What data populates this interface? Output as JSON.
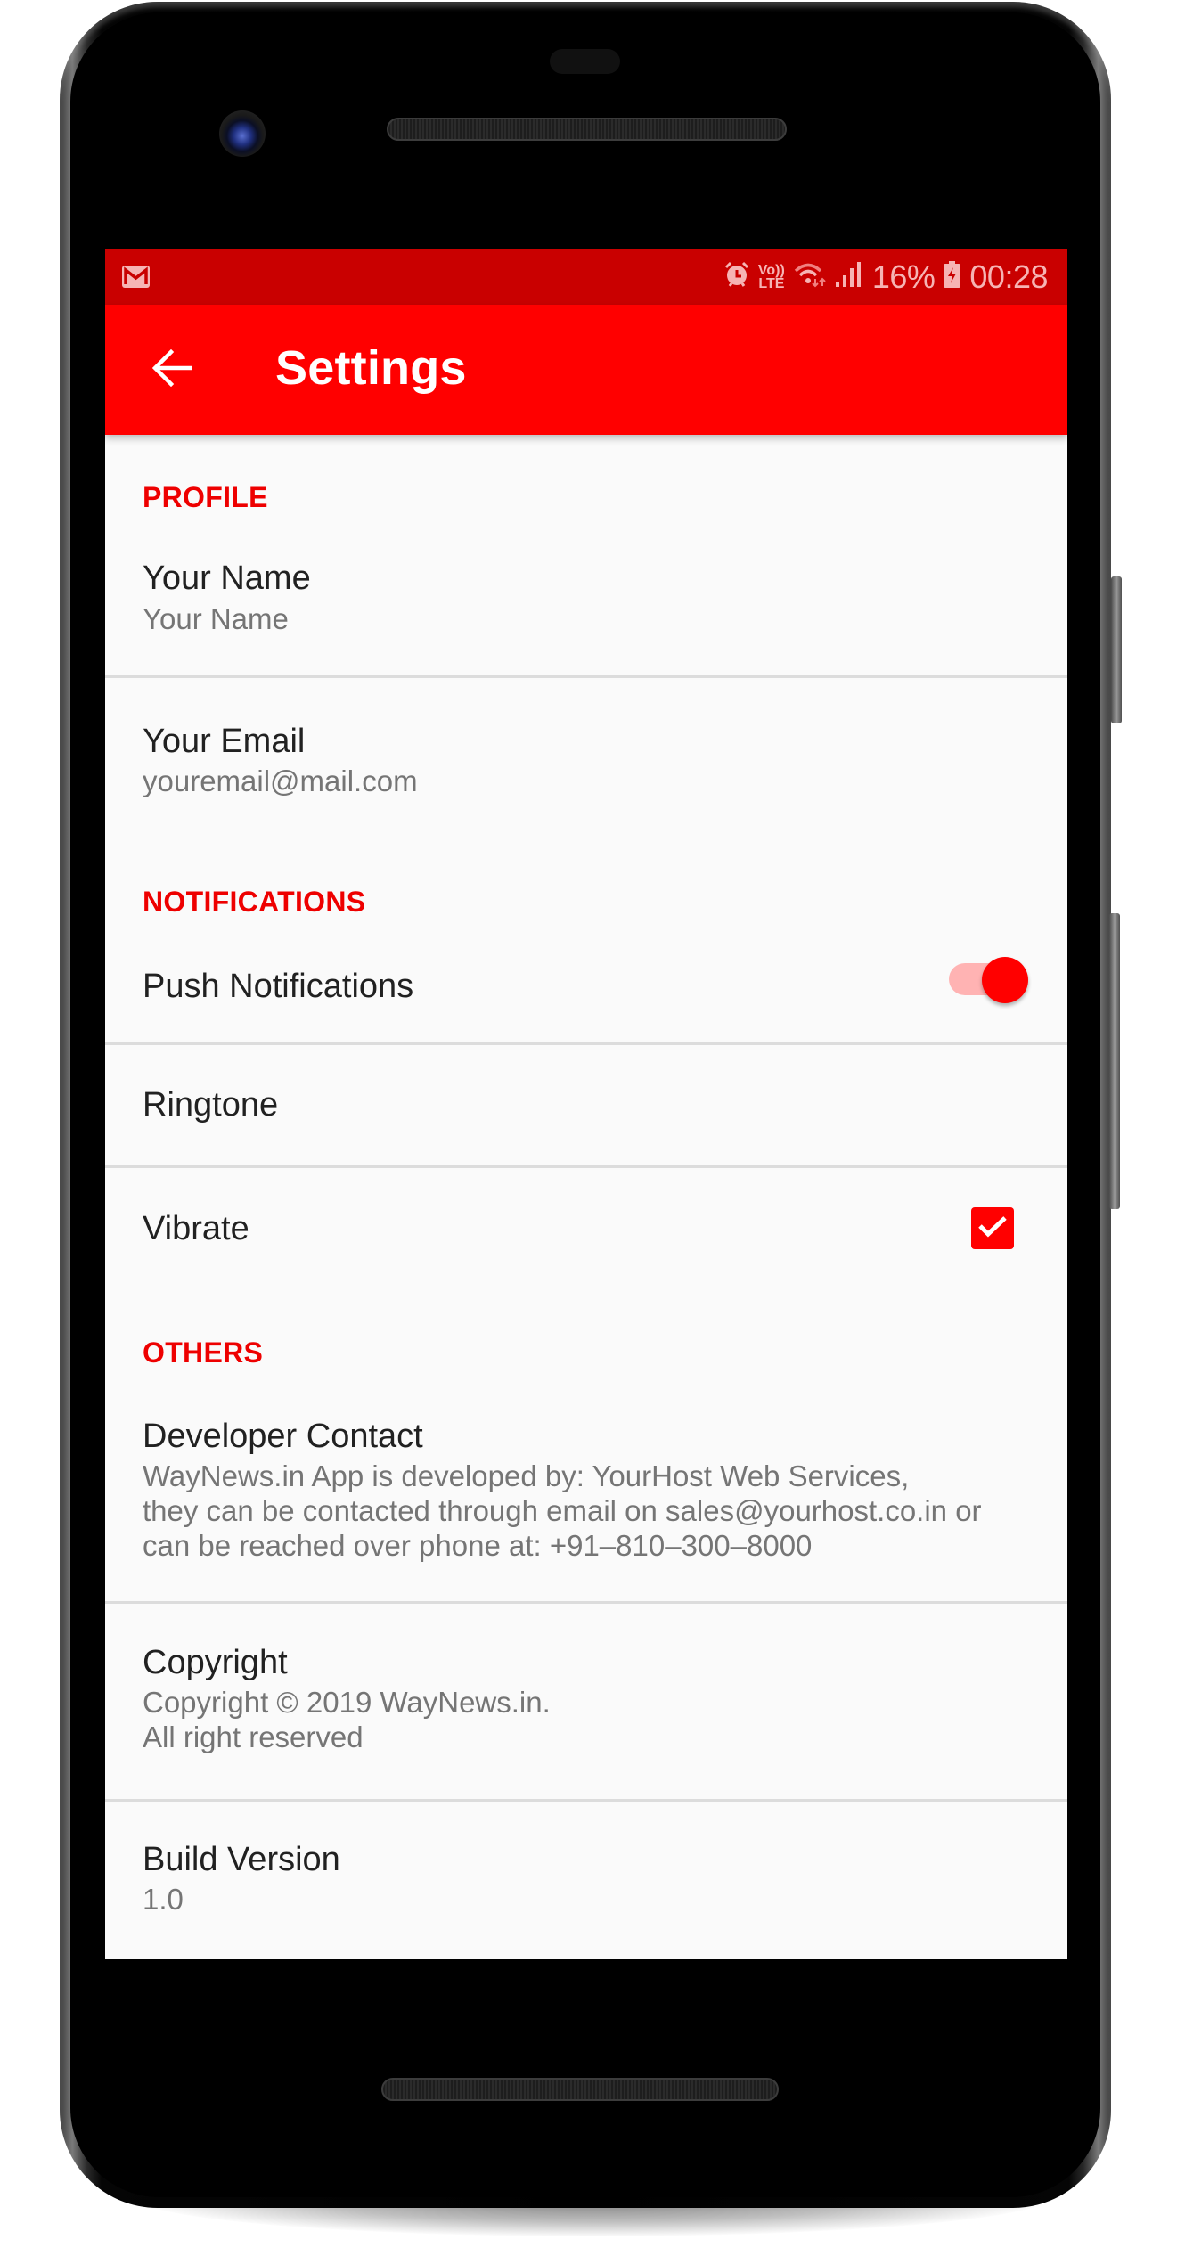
{
  "status_bar": {
    "notification_icons": [
      "gmail-icon"
    ],
    "system_icons": [
      "alarm-icon",
      "volte-icon",
      "wifi-icon",
      "signal-icon"
    ],
    "volte_label_top": "Vo))",
    "volte_label_bottom": "LTE",
    "battery_percent": "16%",
    "battery_icon": "battery-charging-icon",
    "time": "00:28"
  },
  "app_bar": {
    "back_icon": "arrow-left-icon",
    "title": "Settings"
  },
  "colors": {
    "primary": "#ff0000",
    "primary_dark": "#c90000",
    "accent": "#ff0000",
    "background": "#fafafa"
  },
  "categories": [
    {
      "title": "PROFILE",
      "items": [
        {
          "title": "Your Name",
          "summary": "Your Name"
        },
        {
          "title": "Your Email",
          "summary": "youremail@mail.com"
        }
      ]
    },
    {
      "title": "NOTIFICATIONS",
      "items": [
        {
          "title": "Push Notifications",
          "widget": "switch",
          "checked": true
        },
        {
          "title": "Ringtone"
        },
        {
          "title": "Vibrate",
          "widget": "checkbox",
          "checked": true
        }
      ]
    },
    {
      "title": "OTHERS",
      "items": [
        {
          "title": "Developer Contact",
          "summary": "WayNews.in App is developed by: YourHost Web Services,\nthey can be contacted through email on sales@yourhost.co.in or\ncan be reached over phone at: +91–810–300–8000"
        },
        {
          "title": "Copyright",
          "summary": "Copyright © 2019 WayNews.in.\nAll right reserved"
        },
        {
          "title": "Build Version",
          "summary": "1.0"
        }
      ]
    }
  ]
}
